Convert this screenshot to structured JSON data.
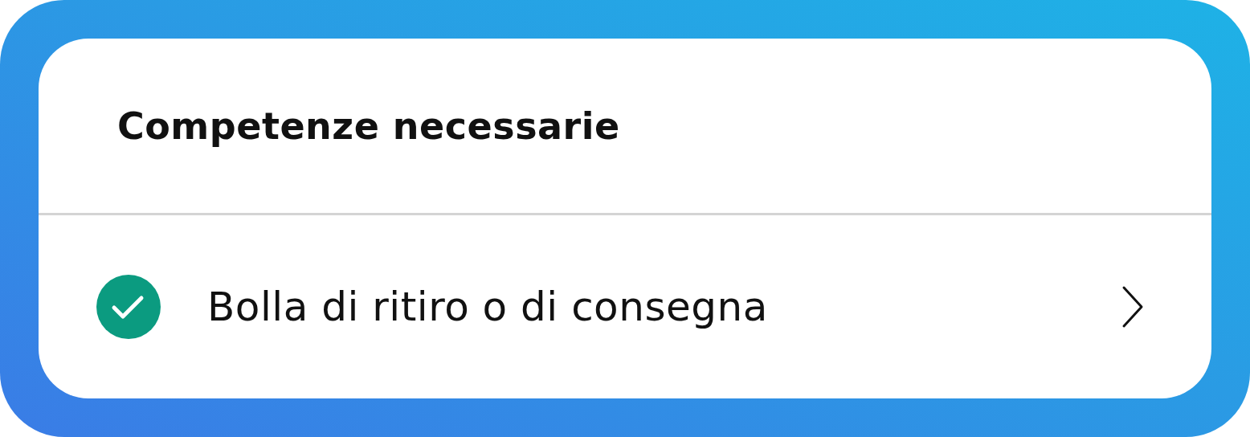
{
  "card": {
    "title": "Competenze necessarie",
    "items": [
      {
        "label": "Bolla di ritiro o di consegna",
        "completed": true
      }
    ]
  }
}
